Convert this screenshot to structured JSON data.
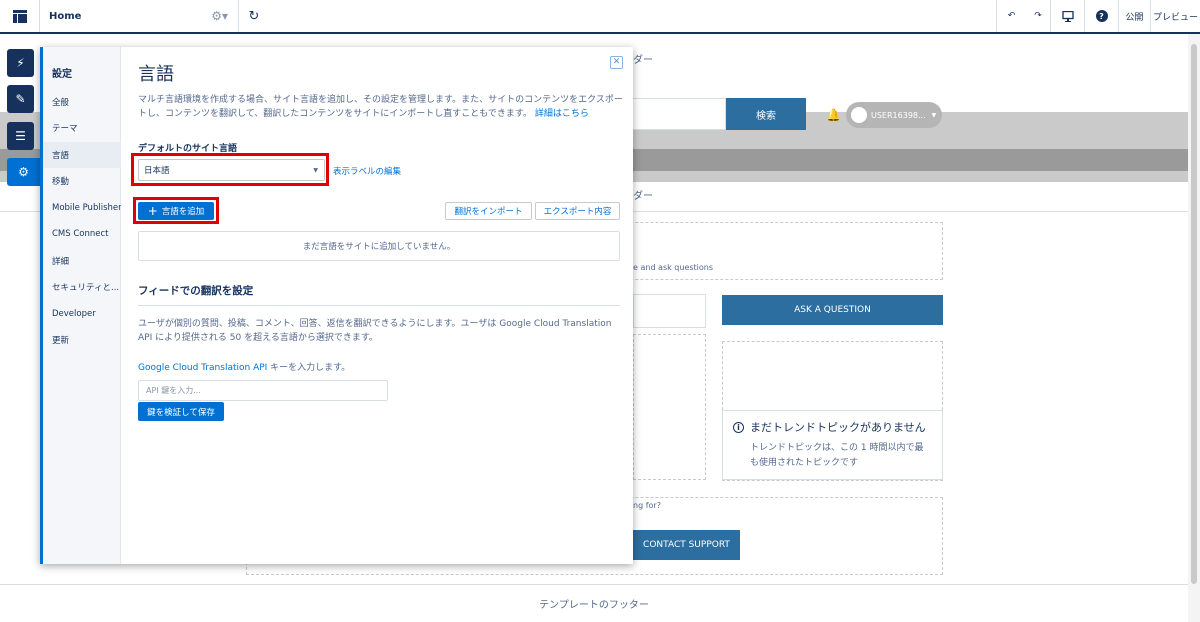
{
  "topbar": {
    "page_name": "Home",
    "publish": "公開",
    "preview": "プレビュー"
  },
  "background": {
    "header_text_1": "ダー",
    "header_text_2": "ダー",
    "search_button": "検索",
    "user_name": "USER16398...",
    "sub_text": "e and ask questions",
    "ask_question": "ASK A QUESTION",
    "trend_title": "まだトレンドトピックがありません",
    "trend_desc": "トレンドトピックは、この 1 時間以内で最も使用されたトピックです",
    "looking_for": "ng for?",
    "contact_support": "CONTACT SUPPORT",
    "footer": "テンプレートのフッター"
  },
  "settings": {
    "nav_title": "設定",
    "nav_items": [
      "全般",
      "テーマ",
      "言語",
      "移動",
      "Mobile Publisher",
      "CMS Connect",
      "詳細",
      "セキュリティと...",
      "Developer",
      "更新"
    ],
    "title": "言語",
    "description": "マルチ言語環境を作成する場合、サイト言語を追加し、その設定を管理します。また、サイトのコンテンツをエクスポートし、コンテンツを翻訳して、翻訳したコンテンツをサイトにインポートし直すこともできます。",
    "learn_more": "詳細はこちら",
    "default_language_label": "デフォルトのサイト言語",
    "default_language_value": "日本語",
    "edit_labels_link": "表示ラベルの編集",
    "add_language_button": "言語を追加",
    "import_button": "翻訳をインポート",
    "export_button": "エクスポート内容",
    "empty_message": "まだ言語をサイトに追加していません。",
    "feed_section_title": "フィードでの翻訳を設定",
    "feed_description": "ユーザが個別の質問、投稿、コメント、回答、返信を翻訳できるようにします。ユーザは Google Cloud Translation API により提供される 50 を超える言語から選択できます。",
    "api_link": "Google Cloud Translation API",
    "api_label_suffix": " キーを入力します。",
    "api_placeholder": "API 鍵を入力...",
    "verify_save_button": "鍵を検証して保存"
  }
}
